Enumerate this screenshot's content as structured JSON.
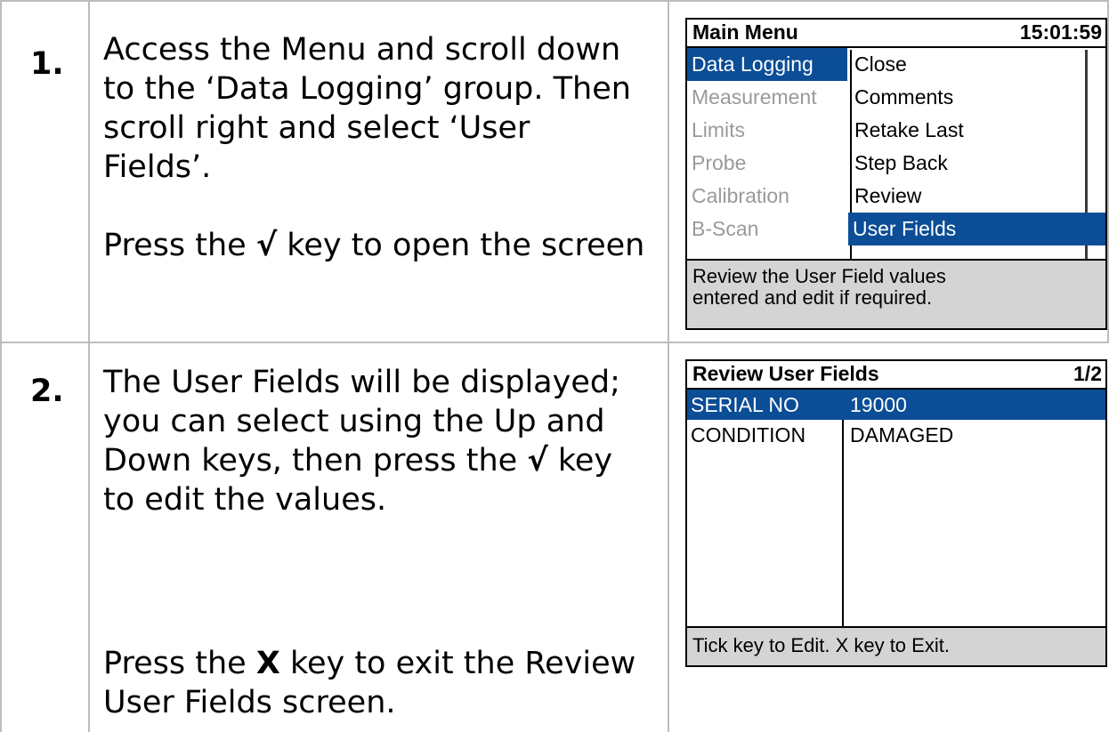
{
  "steps": [
    {
      "number": "1.",
      "paragraph1": "Access the Menu and scroll down to the ‘Data Logging’ group. Then scroll right and select ‘User Fields’.",
      "press_prefix": "Press the ",
      "press_key": "√",
      "press_suffix": " key to open the screen"
    },
    {
      "number": "2.",
      "paragraph1_prefix": "The User Fields will be displayed; you can select using the Up and Down keys, then press the ",
      "paragraph1_key": "√",
      "paragraph1_suffix": " key to edit the values.",
      "press_prefix": "Press the ",
      "press_key": "X",
      "press_suffix": " key to exit the Review User Fields screen."
    }
  ],
  "main_menu_screen": {
    "title": "Main Menu",
    "time": "15:01:59",
    "groups": [
      "Data Logging",
      "Measurement",
      "Limits",
      "Probe",
      "Calibration",
      "B-Scan"
    ],
    "selected_group": "Data Logging",
    "items": [
      "Close",
      "Comments",
      "Retake Last",
      "Step Back",
      "Review",
      "User Fields"
    ],
    "selected_item": "User Fields",
    "footer": "Review the User Field values entered and edit if required."
  },
  "user_fields_screen": {
    "title": "Review User Fields",
    "page": "1/2",
    "rows": [
      {
        "field": "SERIAL NO",
        "value": "19000"
      },
      {
        "field": "CONDITION",
        "value": "DAMAGED"
      }
    ],
    "footer": "Tick key to Edit. X key to Exit."
  },
  "colors": {
    "selection": "#0b4d96",
    "footer_bg": "#d4d4d4",
    "grid": "#bdbdbd",
    "disabled_text": "#9a9a9a"
  }
}
